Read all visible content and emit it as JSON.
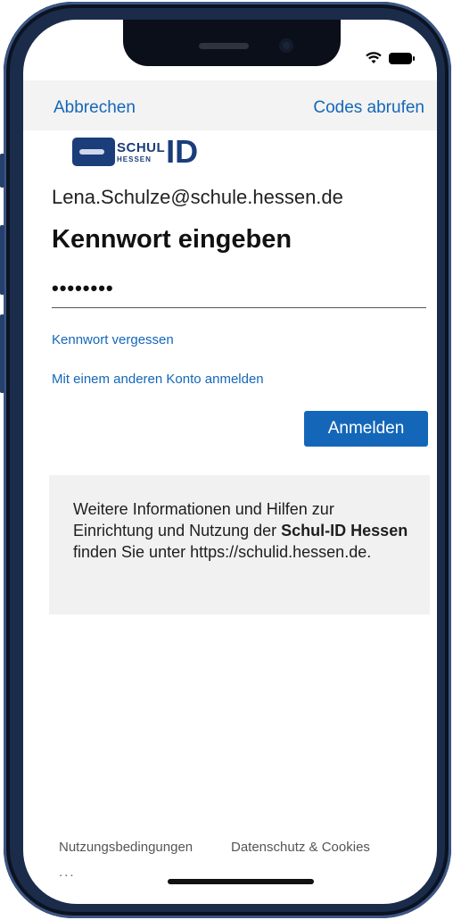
{
  "topbar": {
    "cancel_label": "Abbrechen",
    "codes_label": "Codes abrufen"
  },
  "logo": {
    "schul": "SCHUL",
    "hessen": "HESSEN",
    "id": "ID"
  },
  "account": {
    "email": "Lena.Schulze@schule.hessen.de"
  },
  "form": {
    "heading": "Kennwort eingeben",
    "password_value": "••••••••",
    "forgot_label": "Kennwort vergessen",
    "other_account_label": "Mit einem anderen Konto anmelden",
    "signin_label": "Anmelden"
  },
  "info": {
    "text_1": "Weitere Informationen und Hilfen zur Einrichtung und Nutzung der ",
    "bold": "Schul-ID Hessen",
    "text_2": " finden Sie unter https://schulid.hessen.de."
  },
  "footer": {
    "terms_label": "Nutzungsbedingungen",
    "privacy_label": "Datenschutz & Cookies",
    "more_label": "..."
  },
  "colors": {
    "accent": "#1467b8",
    "frame": "#1b2b4a",
    "logo": "#1b3d7a"
  }
}
